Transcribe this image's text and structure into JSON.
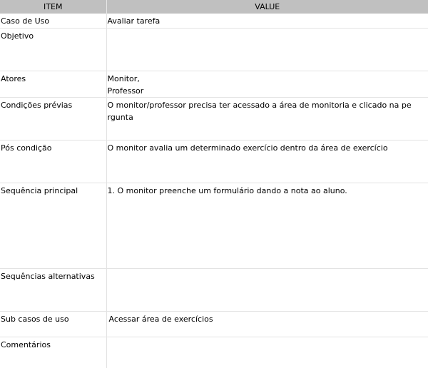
{
  "header": {
    "item_label": "ITEM",
    "value_label": "VALUE"
  },
  "rows": [
    {
      "item": "Caso de Uso",
      "value": "Avaliar tarefa"
    },
    {
      "item": "Objetivo",
      "value": ""
    },
    {
      "item": "Atores",
      "value_lines": [
        "Monitor,",
        "Professor"
      ]
    },
    {
      "item": "Condições prévias",
      "value": "O monitor/professor  precisa ter acessado a área de monitoria e clicado na pergunta"
    },
    {
      "item": "Pós condição",
      "value": "O monitor avalia um determinado exercício dentro da área de exercício"
    },
    {
      "item": "Sequência principal",
      "value": "1. O monitor preenche um formulário dando a nota ao aluno."
    },
    {
      "item": "Sequências alternativas",
      "value": ""
    },
    {
      "item": "Sub casos de uso",
      "value": "Acessar área de exercícios"
    },
    {
      "item": "Comentários",
      "value": ""
    }
  ]
}
